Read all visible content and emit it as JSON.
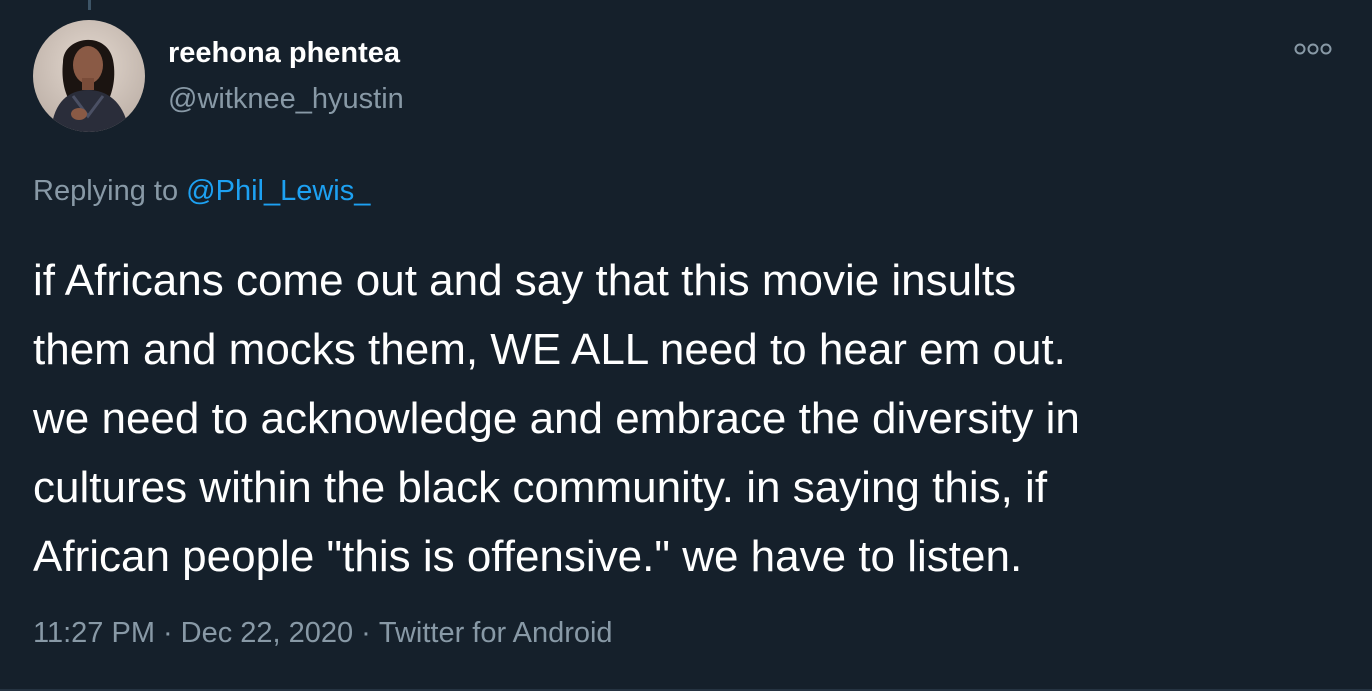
{
  "author": {
    "display_name": "reehona phentea",
    "handle": "@witknee_hyustin",
    "avatar_icon": "profile-photo"
  },
  "reply": {
    "prefix": "Replying to",
    "mention": "@Phil_Lewis_"
  },
  "tweet": {
    "lines": [
      "if Africans come out and say that this movie insults",
      "them and mocks them, WE ALL need to hear em out.",
      "we need to acknowledge and embrace the diversity in",
      "cultures within the black community. in saying this, if",
      "African people \"this is offensive.\" we have to listen."
    ]
  },
  "meta": {
    "time": "11:27 PM",
    "separator": "·",
    "date": "Dec 22, 2020",
    "source": "Twitter for Android"
  },
  "menu": {
    "icon": "more-options-icon"
  },
  "colors": {
    "background": "#15202b",
    "primary_text": "#ffffff",
    "secondary_text": "#8899a6",
    "link": "#1da1f2"
  }
}
